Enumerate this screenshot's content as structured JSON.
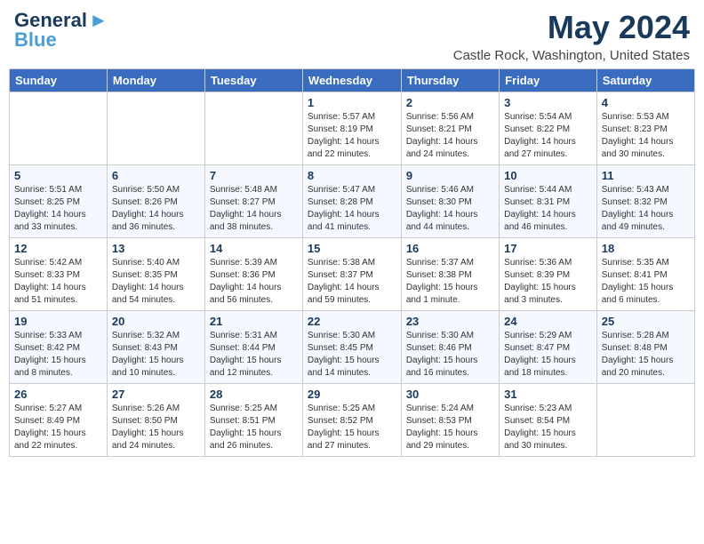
{
  "header": {
    "logo_line1": "General",
    "logo_line2": "Blue",
    "title": "May 2024",
    "subtitle": "Castle Rock, Washington, United States"
  },
  "weekdays": [
    "Sunday",
    "Monday",
    "Tuesday",
    "Wednesday",
    "Thursday",
    "Friday",
    "Saturday"
  ],
  "weeks": [
    [
      {
        "day": "",
        "info": ""
      },
      {
        "day": "",
        "info": ""
      },
      {
        "day": "",
        "info": ""
      },
      {
        "day": "1",
        "info": "Sunrise: 5:57 AM\nSunset: 8:19 PM\nDaylight: 14 hours\nand 22 minutes."
      },
      {
        "day": "2",
        "info": "Sunrise: 5:56 AM\nSunset: 8:21 PM\nDaylight: 14 hours\nand 24 minutes."
      },
      {
        "day": "3",
        "info": "Sunrise: 5:54 AM\nSunset: 8:22 PM\nDaylight: 14 hours\nand 27 minutes."
      },
      {
        "day": "4",
        "info": "Sunrise: 5:53 AM\nSunset: 8:23 PM\nDaylight: 14 hours\nand 30 minutes."
      }
    ],
    [
      {
        "day": "5",
        "info": "Sunrise: 5:51 AM\nSunset: 8:25 PM\nDaylight: 14 hours\nand 33 minutes."
      },
      {
        "day": "6",
        "info": "Sunrise: 5:50 AM\nSunset: 8:26 PM\nDaylight: 14 hours\nand 36 minutes."
      },
      {
        "day": "7",
        "info": "Sunrise: 5:48 AM\nSunset: 8:27 PM\nDaylight: 14 hours\nand 38 minutes."
      },
      {
        "day": "8",
        "info": "Sunrise: 5:47 AM\nSunset: 8:28 PM\nDaylight: 14 hours\nand 41 minutes."
      },
      {
        "day": "9",
        "info": "Sunrise: 5:46 AM\nSunset: 8:30 PM\nDaylight: 14 hours\nand 44 minutes."
      },
      {
        "day": "10",
        "info": "Sunrise: 5:44 AM\nSunset: 8:31 PM\nDaylight: 14 hours\nand 46 minutes."
      },
      {
        "day": "11",
        "info": "Sunrise: 5:43 AM\nSunset: 8:32 PM\nDaylight: 14 hours\nand 49 minutes."
      }
    ],
    [
      {
        "day": "12",
        "info": "Sunrise: 5:42 AM\nSunset: 8:33 PM\nDaylight: 14 hours\nand 51 minutes."
      },
      {
        "day": "13",
        "info": "Sunrise: 5:40 AM\nSunset: 8:35 PM\nDaylight: 14 hours\nand 54 minutes."
      },
      {
        "day": "14",
        "info": "Sunrise: 5:39 AM\nSunset: 8:36 PM\nDaylight: 14 hours\nand 56 minutes."
      },
      {
        "day": "15",
        "info": "Sunrise: 5:38 AM\nSunset: 8:37 PM\nDaylight: 14 hours\nand 59 minutes."
      },
      {
        "day": "16",
        "info": "Sunrise: 5:37 AM\nSunset: 8:38 PM\nDaylight: 15 hours\nand 1 minute."
      },
      {
        "day": "17",
        "info": "Sunrise: 5:36 AM\nSunset: 8:39 PM\nDaylight: 15 hours\nand 3 minutes."
      },
      {
        "day": "18",
        "info": "Sunrise: 5:35 AM\nSunset: 8:41 PM\nDaylight: 15 hours\nand 6 minutes."
      }
    ],
    [
      {
        "day": "19",
        "info": "Sunrise: 5:33 AM\nSunset: 8:42 PM\nDaylight: 15 hours\nand 8 minutes."
      },
      {
        "day": "20",
        "info": "Sunrise: 5:32 AM\nSunset: 8:43 PM\nDaylight: 15 hours\nand 10 minutes."
      },
      {
        "day": "21",
        "info": "Sunrise: 5:31 AM\nSunset: 8:44 PM\nDaylight: 15 hours\nand 12 minutes."
      },
      {
        "day": "22",
        "info": "Sunrise: 5:30 AM\nSunset: 8:45 PM\nDaylight: 15 hours\nand 14 minutes."
      },
      {
        "day": "23",
        "info": "Sunrise: 5:30 AM\nSunset: 8:46 PM\nDaylight: 15 hours\nand 16 minutes."
      },
      {
        "day": "24",
        "info": "Sunrise: 5:29 AM\nSunset: 8:47 PM\nDaylight: 15 hours\nand 18 minutes."
      },
      {
        "day": "25",
        "info": "Sunrise: 5:28 AM\nSunset: 8:48 PM\nDaylight: 15 hours\nand 20 minutes."
      }
    ],
    [
      {
        "day": "26",
        "info": "Sunrise: 5:27 AM\nSunset: 8:49 PM\nDaylight: 15 hours\nand 22 minutes."
      },
      {
        "day": "27",
        "info": "Sunrise: 5:26 AM\nSunset: 8:50 PM\nDaylight: 15 hours\nand 24 minutes."
      },
      {
        "day": "28",
        "info": "Sunrise: 5:25 AM\nSunset: 8:51 PM\nDaylight: 15 hours\nand 26 minutes."
      },
      {
        "day": "29",
        "info": "Sunrise: 5:25 AM\nSunset: 8:52 PM\nDaylight: 15 hours\nand 27 minutes."
      },
      {
        "day": "30",
        "info": "Sunrise: 5:24 AM\nSunset: 8:53 PM\nDaylight: 15 hours\nand 29 minutes."
      },
      {
        "day": "31",
        "info": "Sunrise: 5:23 AM\nSunset: 8:54 PM\nDaylight: 15 hours\nand 30 minutes."
      },
      {
        "day": "",
        "info": ""
      }
    ]
  ]
}
